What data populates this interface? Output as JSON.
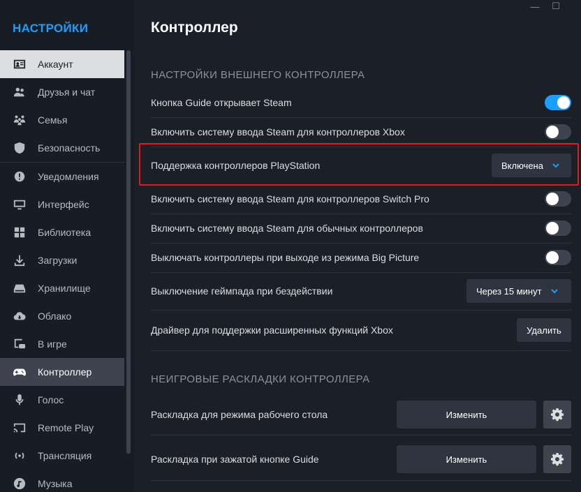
{
  "sidebar": {
    "title": "НАСТРОЙКИ",
    "items": [
      {
        "label": "Аккаунт",
        "icon": "account-card-icon"
      },
      {
        "label": "Друзья и чат",
        "icon": "friends-icon"
      },
      {
        "label": "Семья",
        "icon": "family-icon"
      },
      {
        "label": "Безопасность",
        "icon": "shield-icon"
      },
      {
        "label": "Уведомления",
        "icon": "notification-icon"
      },
      {
        "label": "Интерфейс",
        "icon": "monitor-icon"
      },
      {
        "label": "Библиотека",
        "icon": "library-grid-icon"
      },
      {
        "label": "Загрузки",
        "icon": "download-icon"
      },
      {
        "label": "Хранилище",
        "icon": "storage-drive-icon"
      },
      {
        "label": "Облако",
        "icon": "cloud-icon"
      },
      {
        "label": "В игре",
        "icon": "in-game-icon"
      },
      {
        "label": "Контроллер",
        "icon": "gamepad-icon"
      },
      {
        "label": "Голос",
        "icon": "microphone-icon"
      },
      {
        "label": "Remote Play",
        "icon": "cast-icon"
      },
      {
        "label": "Трансляция",
        "icon": "broadcast-icon"
      },
      {
        "label": "Музыка",
        "icon": "music-icon"
      }
    ]
  },
  "window": {
    "minimize": "—",
    "maximize": "☐"
  },
  "main": {
    "title": "Контроллер",
    "section1": "Настройки внешнего контроллера",
    "rows": {
      "guide": {
        "label": "Кнопка Guide открывает Steam",
        "on": true
      },
      "xbox": {
        "label": "Включить систему ввода Steam для контроллеров Xbox",
        "on": false
      },
      "ps": {
        "label": "Поддержка контроллеров PlayStation",
        "value": "Включена"
      },
      "switch": {
        "label": "Включить систему ввода Steam для контроллеров Switch Pro",
        "on": false
      },
      "generic": {
        "label": "Включить систему ввода Steam для обычных контроллеров",
        "on": false
      },
      "bigpicture": {
        "label": "Выключать контроллеры при выходе из режима Big Picture",
        "on": false
      },
      "idle": {
        "label": "Выключение геймпада при бездействии",
        "value": "Через 15 минут"
      },
      "driver": {
        "label": "Драйвер для поддержки расширенных функций Xbox",
        "button": "Удалить"
      }
    },
    "section2": "Неигровые раскладки контроллера",
    "layouts": {
      "desktop": {
        "label": "Раскладка для режима рабочего стола",
        "button": "Изменить"
      },
      "guide": {
        "label": "Раскладка при зажатой кнопке Guide",
        "button": "Изменить"
      }
    }
  },
  "colors": {
    "accent": "#1a9fff",
    "highlight": "#e01b1b",
    "background": "#1b2028",
    "sidebar": "#171d25"
  }
}
